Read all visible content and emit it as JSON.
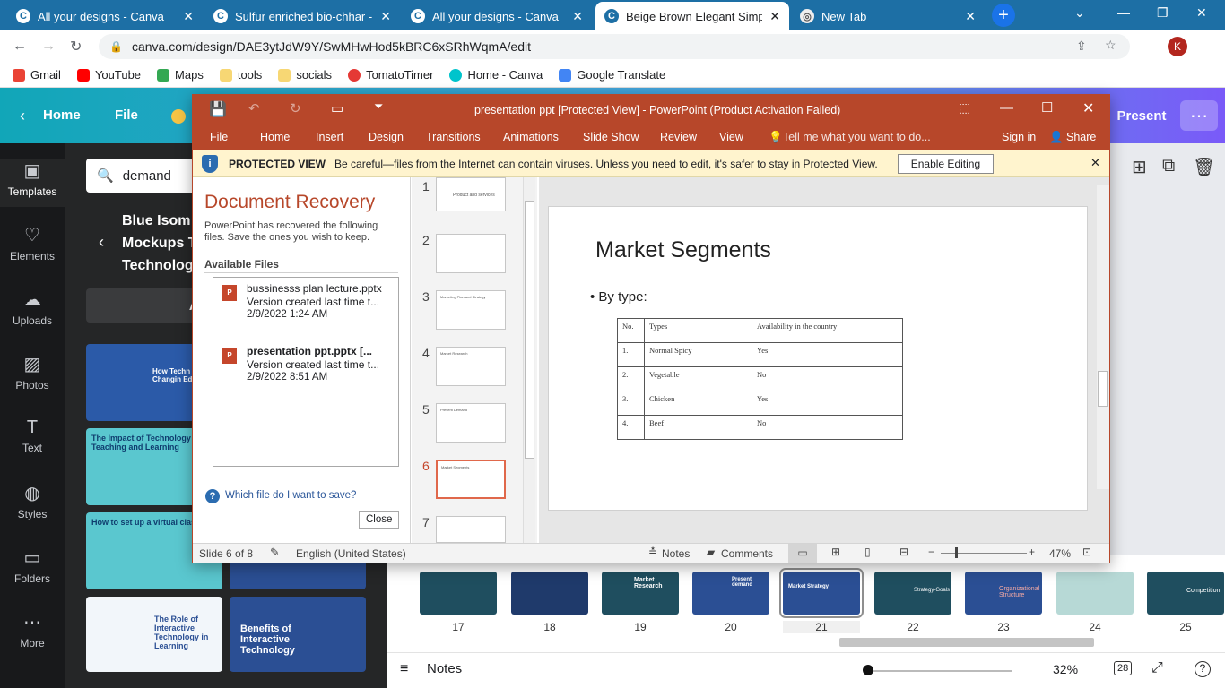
{
  "browser": {
    "tabs": [
      {
        "title": "All your designs - Canva"
      },
      {
        "title": "Sulfur enriched bio-chhar - R"
      },
      {
        "title": "All your designs - Canva"
      },
      {
        "title": "Beige Brown Elegant Simple"
      },
      {
        "title": "New Tab"
      }
    ],
    "url": "canva.com/design/DAE3ytJdW9Y/SwMHwHod5kBRC6xSRhWqmA/edit",
    "avatar": "K",
    "bookmarks": [
      "Gmail",
      "YouTube",
      "Maps",
      "tools",
      "socials",
      "TomatoTimer",
      "Home - Canva",
      "Google Translate"
    ]
  },
  "canva": {
    "home": "Home",
    "file": "File",
    "present": "Present",
    "search_value": "demand",
    "rail": [
      "Templates",
      "Elements",
      "Uploads",
      "Photos",
      "Text",
      "Styles",
      "Folders",
      "More"
    ],
    "panel_heading": [
      "Blue Isom",
      "Mockups T",
      "Technolog"
    ],
    "apply_btn": "App",
    "thumbs": [
      "How Techn is Changin Education",
      "The Impact of Technology on Teaching and Learning",
      "How to set up a virtual class",
      "The Role of Interactive Technology in Learning",
      "Benefits of Interactive Technology"
    ],
    "pages": [
      {
        "num": "17",
        "label": ""
      },
      {
        "num": "18",
        "label": ""
      },
      {
        "num": "19",
        "label": "Market Research"
      },
      {
        "num": "20",
        "label": "Present demand"
      },
      {
        "num": "21",
        "label": "Market Strategy"
      },
      {
        "num": "22",
        "label": "Strategy-Goals"
      },
      {
        "num": "23",
        "label": "Organizational Structure"
      },
      {
        "num": "24",
        "label": ""
      },
      {
        "num": "25",
        "label": "Competition"
      }
    ],
    "notes": "Notes",
    "zoom": "32%",
    "page_count": "28"
  },
  "ppt": {
    "title": "presentation ppt [Protected View] - PowerPoint (Product Activation Failed)",
    "tabs": [
      "File",
      "Home",
      "Insert",
      "Design",
      "Transitions",
      "Animations",
      "Slide Show",
      "Review",
      "View"
    ],
    "tell_me": "Tell me what you want to do...",
    "sign_in": "Sign in",
    "share": "Share",
    "protected_label": "PROTECTED VIEW",
    "protected_msg": "Be careful—files from the Internet can contain viruses. Unless you need to edit, it's safer to stay in Protected View.",
    "enable_editing": "Enable Editing",
    "recovery": {
      "title": "Document Recovery",
      "desc": "PowerPoint has recovered the following files.  Save the ones you wish to keep.",
      "available": "Available Files",
      "files": [
        {
          "name": "bussinesss plan lecture.pptx",
          "version": "Version created last time t...",
          "date": "2/9/2022 1:24 AM"
        },
        {
          "name": "presentation ppt.pptx  [...",
          "version": "Version created last time t...",
          "date": "2/9/2022 8:51 AM"
        }
      ],
      "help": "Which file do I want to save?",
      "close": "Close"
    },
    "thumbs": [
      {
        "num": "1",
        "text": "Product and services"
      },
      {
        "num": "2",
        "text": ""
      },
      {
        "num": "3",
        "text": "Marketing Plan and Strategy"
      },
      {
        "num": "4",
        "text": "Market Research"
      },
      {
        "num": "5",
        "text": "Present Demand"
      },
      {
        "num": "6",
        "text": "Market Segments"
      },
      {
        "num": "7",
        "text": ""
      }
    ],
    "slide": {
      "title": "Market Segments",
      "bullet": "• By type:",
      "table": [
        [
          "No.",
          "Types",
          "Availability in the country"
        ],
        [
          "1.",
          "Normal Spicy",
          "Yes"
        ],
        [
          "2.",
          "Vegetable",
          "No"
        ],
        [
          "3.",
          "Chicken",
          "Yes"
        ],
        [
          "4.",
          "Beef",
          "No"
        ]
      ]
    },
    "status": {
      "slide": "Slide 6 of 8",
      "language": "English (United States)",
      "notes": "Notes",
      "comments": "Comments",
      "zoom": "47%"
    }
  }
}
